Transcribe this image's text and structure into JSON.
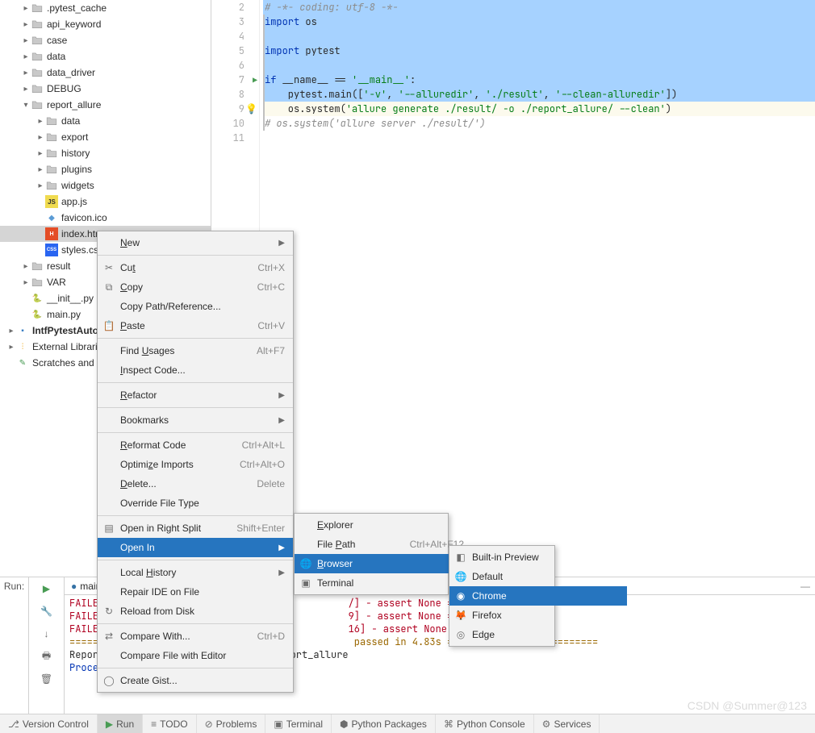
{
  "tree": [
    {
      "depth": 1,
      "chev": ">",
      "icon": "folder",
      "label": ".pytest_cache"
    },
    {
      "depth": 1,
      "chev": ">",
      "icon": "folder",
      "label": "api_keyword"
    },
    {
      "depth": 1,
      "chev": ">",
      "icon": "folder",
      "label": "case"
    },
    {
      "depth": 1,
      "chev": ">",
      "icon": "folder",
      "label": "data"
    },
    {
      "depth": 1,
      "chev": ">",
      "icon": "folder",
      "label": "data_driver"
    },
    {
      "depth": 1,
      "chev": ">",
      "icon": "folder",
      "label": "DEBUG"
    },
    {
      "depth": 1,
      "chev": "v",
      "icon": "folder",
      "label": "report_allure"
    },
    {
      "depth": 2,
      "chev": ">",
      "icon": "folder",
      "label": "data"
    },
    {
      "depth": 2,
      "chev": ">",
      "icon": "folder",
      "label": "export"
    },
    {
      "depth": 2,
      "chev": ">",
      "icon": "folder",
      "label": "history"
    },
    {
      "depth": 2,
      "chev": ">",
      "icon": "folder",
      "label": "plugins"
    },
    {
      "depth": 2,
      "chev": ">",
      "icon": "folder",
      "label": "widgets"
    },
    {
      "depth": 2,
      "chev": "",
      "icon": "js",
      "label": "app.js"
    },
    {
      "depth": 2,
      "chev": "",
      "icon": "ico",
      "label": "favicon.ico"
    },
    {
      "depth": 2,
      "chev": "",
      "icon": "html",
      "label": "index.htm",
      "selected": true
    },
    {
      "depth": 2,
      "chev": "",
      "icon": "css",
      "label": "styles.cs"
    },
    {
      "depth": 1,
      "chev": ">",
      "icon": "folder",
      "label": "result"
    },
    {
      "depth": 1,
      "chev": ">",
      "icon": "folder",
      "label": "VAR"
    },
    {
      "depth": 1,
      "chev": "",
      "icon": "py",
      "label": "__init__.py"
    },
    {
      "depth": 1,
      "chev": "",
      "icon": "py",
      "label": "main.py"
    },
    {
      "depth": 0,
      "chev": ">",
      "icon": "root",
      "label": "IntfPytestAuto",
      "bold": true
    },
    {
      "depth": 0,
      "chev": ">",
      "icon": "lib",
      "label": "External Librari"
    },
    {
      "depth": 0,
      "chev": "",
      "icon": "scratch",
      "label": "Scratches and"
    }
  ],
  "gutter_start": 2,
  "code": {
    "2": {
      "cls": "sel",
      "html": "<span class='cm'># -*- coding: utf-8 -*-</span>"
    },
    "3": {
      "cls": "sel fold",
      "html": "<span class='kw'>import</span> os"
    },
    "4": {
      "cls": "sel fold",
      "html": ""
    },
    "5": {
      "cls": "sel fold",
      "html": "<span class='kw'>import</span> pytest"
    },
    "6": {
      "cls": "sel fold",
      "html": ""
    },
    "7": {
      "cls": "sel fold",
      "html": "<span class='kw'>if</span> __name__ == <span class='str'>'__main__'</span>:",
      "run": true
    },
    "8": {
      "cls": "sel fold",
      "html": "    pytest.main([<span class='str'>'-v'</span>, <span class='str'>'--alluredir'</span>, <span class='str'>'./result'</span>, <span class='str'>'--clean-alluredir'</span>])"
    },
    "9": {
      "cls": "hl fold",
      "html": "    os.system(<span class='str'>'allure generate ./result/ -o ./report_allure/ --clean'</span>)",
      "bulb": true
    },
    "10": {
      "cls": "fold",
      "html": "    <span class='cm'># os.system('allure server ./result/')</span>"
    },
    "11": {
      "cls": "",
      "html": ""
    }
  },
  "context_menu": [
    {
      "type": "item",
      "label": "New",
      "arrow": true,
      "under": "N"
    },
    {
      "type": "sep"
    },
    {
      "type": "item",
      "icon": "✂",
      "label": "Cut",
      "short": "Ctrl+X",
      "under": "t"
    },
    {
      "type": "item",
      "icon": "⧉",
      "label": "Copy",
      "short": "Ctrl+C",
      "under": "C"
    },
    {
      "type": "item",
      "label": "Copy Path/Reference..."
    },
    {
      "type": "item",
      "icon": "📋",
      "label": "Paste",
      "short": "Ctrl+V",
      "under": "P"
    },
    {
      "type": "sep"
    },
    {
      "type": "item",
      "label": "Find Usages",
      "short": "Alt+F7",
      "under": "U"
    },
    {
      "type": "item",
      "label": "Inspect Code...",
      "under": "I"
    },
    {
      "type": "sep"
    },
    {
      "type": "item",
      "label": "Refactor",
      "arrow": true,
      "under": "R"
    },
    {
      "type": "sep"
    },
    {
      "type": "item",
      "label": "Bookmarks",
      "arrow": true
    },
    {
      "type": "sep"
    },
    {
      "type": "item",
      "label": "Reformat Code",
      "short": "Ctrl+Alt+L",
      "under": "R"
    },
    {
      "type": "item",
      "label": "Optimize Imports",
      "short": "Ctrl+Alt+O",
      "under": "z"
    },
    {
      "type": "item",
      "label": "Delete...",
      "short": "Delete",
      "under": "D"
    },
    {
      "type": "item",
      "label": "Override File Type"
    },
    {
      "type": "sep"
    },
    {
      "type": "item",
      "icon": "▤",
      "label": "Open in Right Split",
      "short": "Shift+Enter"
    },
    {
      "type": "item",
      "label": "Open In",
      "arrow": true,
      "sel": true
    },
    {
      "type": "sep"
    },
    {
      "type": "item",
      "label": "Local History",
      "arrow": true,
      "under": "H"
    },
    {
      "type": "item",
      "label": "Repair IDE on File"
    },
    {
      "type": "item",
      "icon": "↻",
      "label": "Reload from Disk"
    },
    {
      "type": "sep"
    },
    {
      "type": "item",
      "icon": "⇄",
      "label": "Compare With...",
      "short": "Ctrl+D"
    },
    {
      "type": "item",
      "label": "Compare File with Editor"
    },
    {
      "type": "sep"
    },
    {
      "type": "item",
      "icon": "◯",
      "label": "Create Gist..."
    }
  ],
  "submenu_openin": [
    {
      "type": "item",
      "label": "Explorer",
      "under": "E"
    },
    {
      "type": "item",
      "label": "File Path",
      "short": "Ctrl+Alt+F12",
      "under": "P"
    },
    {
      "type": "item",
      "icon": "🌐",
      "label": "Browser",
      "arrow": true,
      "sel": true,
      "under": "B"
    },
    {
      "type": "item",
      "icon": "▣",
      "label": "Terminal"
    }
  ],
  "submenu_browser": [
    {
      "type": "item",
      "icon": "◧",
      "label": "Built-in Preview"
    },
    {
      "type": "item",
      "icon": "🌐",
      "label": "Default"
    },
    {
      "type": "item",
      "icon": "◉",
      "label": "Chrome",
      "sel": true
    },
    {
      "type": "item",
      "icon": "🦊",
      "label": "Firefox"
    },
    {
      "type": "item",
      "icon": "◎",
      "label": "Edge"
    }
  ],
  "run": {
    "label": "Run:",
    "tab": "main",
    "lines": [
      {
        "cls": "fail",
        "text": "FAILED "
      },
      {
        "cls": "fail",
        "text": "FAILED "
      },
      {
        "cls": "fail",
        "text": "FAILED "
      },
      {
        "cls": "warn",
        "text": "======="
      },
      {
        "cls": "",
        "text": "Report successfully generated to .\\report_allure"
      },
      {
        "cls": "",
        "text": ""
      },
      {
        "cls": "ok",
        "text": "Process finished with exit code 0"
      }
    ],
    "frag": {
      "l1": "/] - assert None == 10",
      "l2": "9] - assert None == 0",
      "l3": "16] - assert None == 10",
      "l4": " passed in 4.83s =========================="
    }
  },
  "status": [
    {
      "icon": "⎇",
      "label": "Version Control"
    },
    {
      "icon": "▶",
      "label": "Run",
      "active": true,
      "iconcls": "run-icon"
    },
    {
      "icon": "≡",
      "label": "TODO"
    },
    {
      "icon": "⊘",
      "label": "Problems"
    },
    {
      "icon": "▣",
      "label": "Terminal"
    },
    {
      "icon": "⬢",
      "label": "Python Packages"
    },
    {
      "icon": "⌘",
      "label": "Python Console"
    },
    {
      "icon": "⚙",
      "label": "Services"
    }
  ],
  "watermark": "CSDN @Summer@123"
}
